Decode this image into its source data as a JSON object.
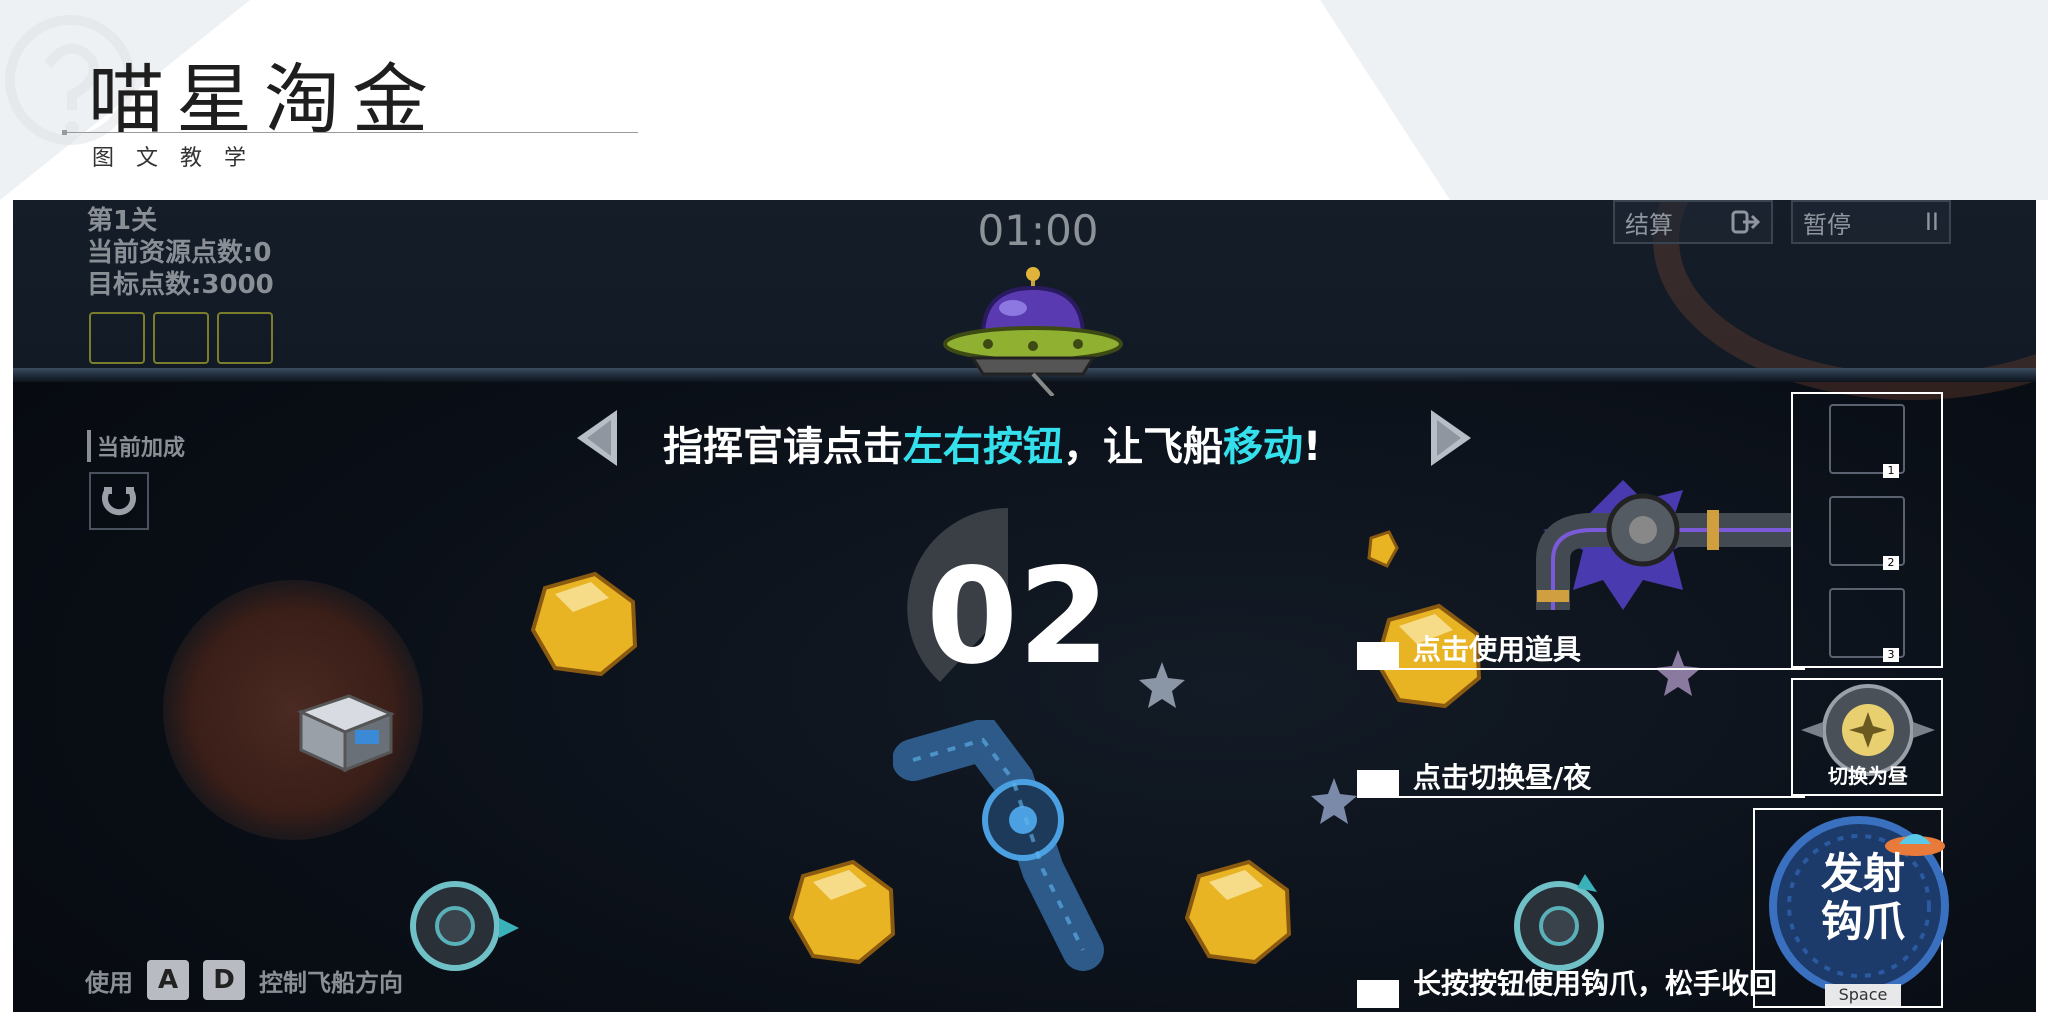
{
  "slide": {
    "title": "喵星淘金",
    "subtitle": "图文教学"
  },
  "hud": {
    "level": "第1关",
    "current_points": "当前资源点数:0",
    "target_points": "目标点数:3000",
    "timer": "01:00",
    "settle_label": "结算",
    "pause_label": "暂停",
    "pause_icon": "II",
    "bonus_label": "当前加成"
  },
  "tutorial": {
    "instruction_prefix": "指挥官请点击",
    "instruction_hl1": "左右按钮",
    "instruction_mid": "，让飞船",
    "instruction_hl2": "移动",
    "instruction_suffix": "!",
    "countdown": "02",
    "use_item": "点击使用道具",
    "switch_daynight": "点击切换昼/夜",
    "hook_hint": "长按按钮使用钩爪，松手收回"
  },
  "items": {
    "slots": [
      "1",
      "2",
      "3"
    ],
    "daynight_button": "切换为昼",
    "fire_button_line1": "发射",
    "fire_button_line2": "钩爪",
    "fire_key": "Space"
  },
  "controls": {
    "use_label": "使用",
    "key_left": "A",
    "key_right": "D",
    "direction_label": "控制飞船方向"
  },
  "colors": {
    "highlight": "#34e0ec",
    "slot_border": "#7a7e2a",
    "gold": "#e8b424"
  }
}
